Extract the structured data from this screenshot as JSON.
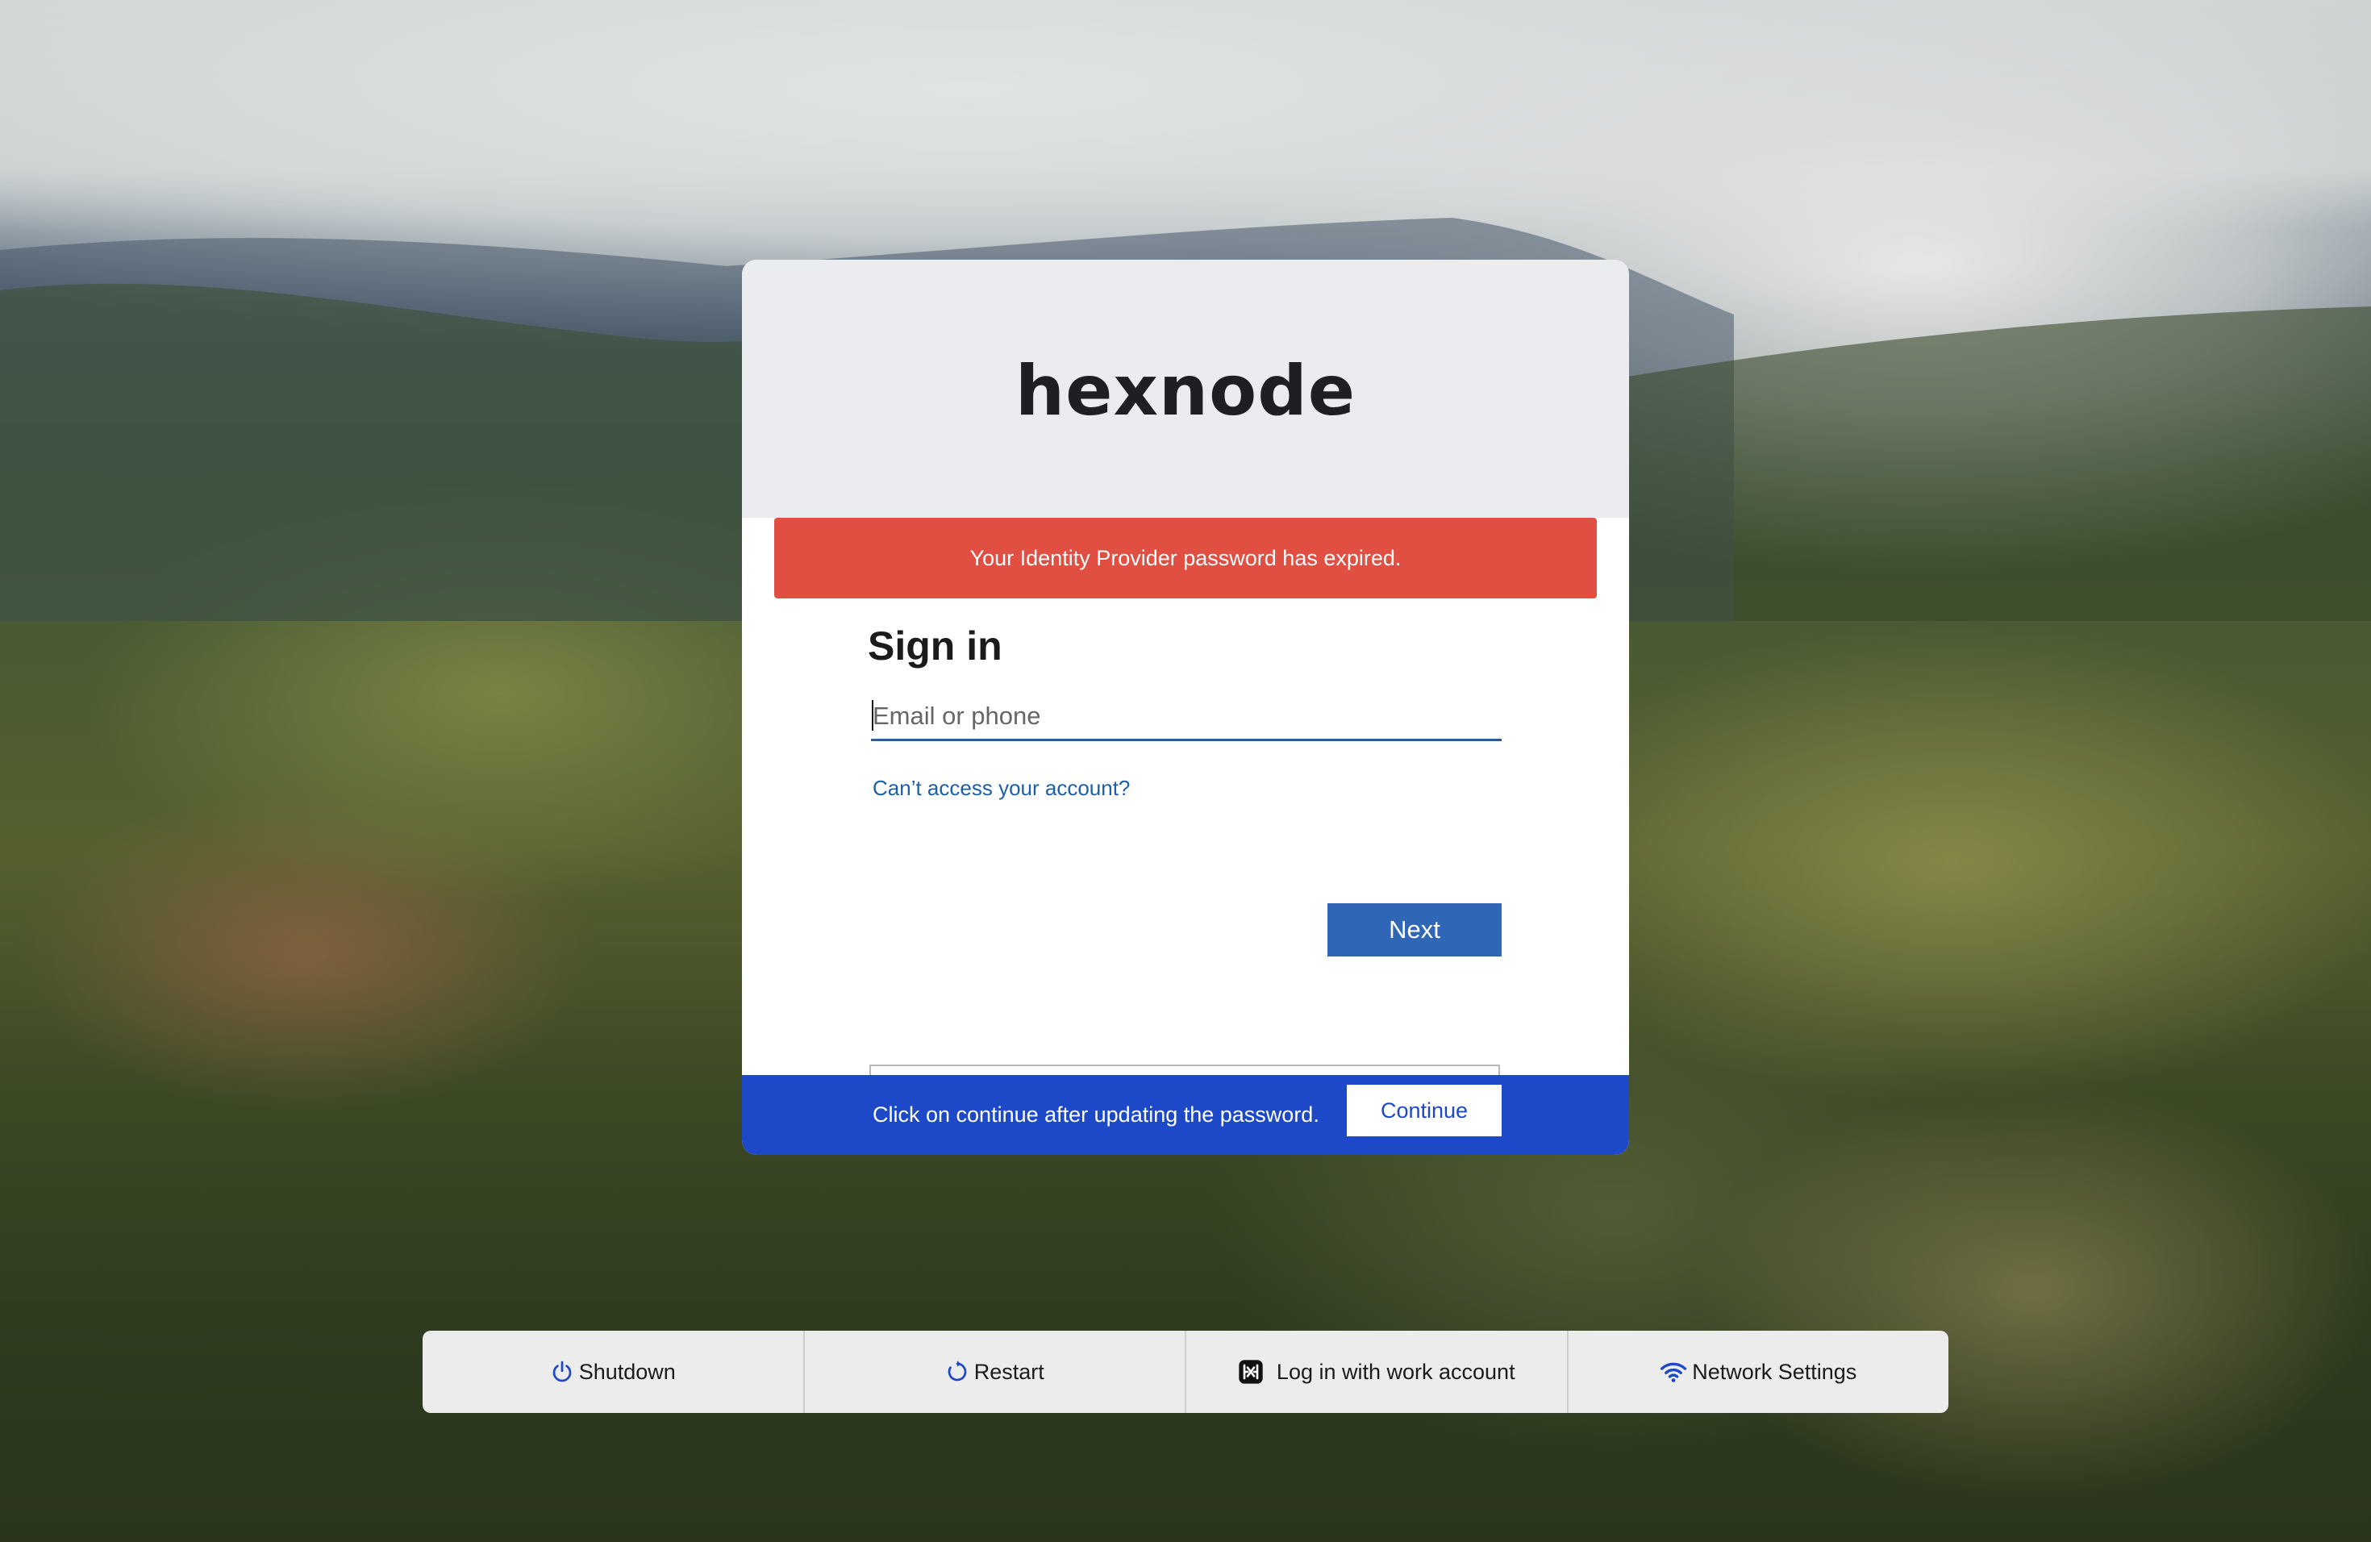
{
  "login": {
    "logo_text": "hexnode",
    "error_message": "Your Identity Provider password has expired.",
    "title": "Sign in",
    "email_placeholder": "Email or phone",
    "email_value": "",
    "cant_access_link": "Can’t access your account?",
    "next_button": "Next"
  },
  "footer": {
    "message": "Click on continue after updating the password.",
    "continue_button": "Continue"
  },
  "bottom_bar": {
    "shutdown": {
      "label": "Shutdown",
      "icon": "power-icon"
    },
    "restart": {
      "label": "Restart",
      "icon": "restart-icon"
    },
    "work_account": {
      "label": "Log in with work account",
      "icon": "hexnode-icon"
    },
    "network": {
      "label": "Network Settings",
      "icon": "wifi-icon"
    }
  },
  "colors": {
    "error": "#e04f42",
    "primary_button": "#2f66b5",
    "footer_band": "#1d49c9",
    "link": "#1d5fa8",
    "icon_blue": "#1d49c9"
  }
}
